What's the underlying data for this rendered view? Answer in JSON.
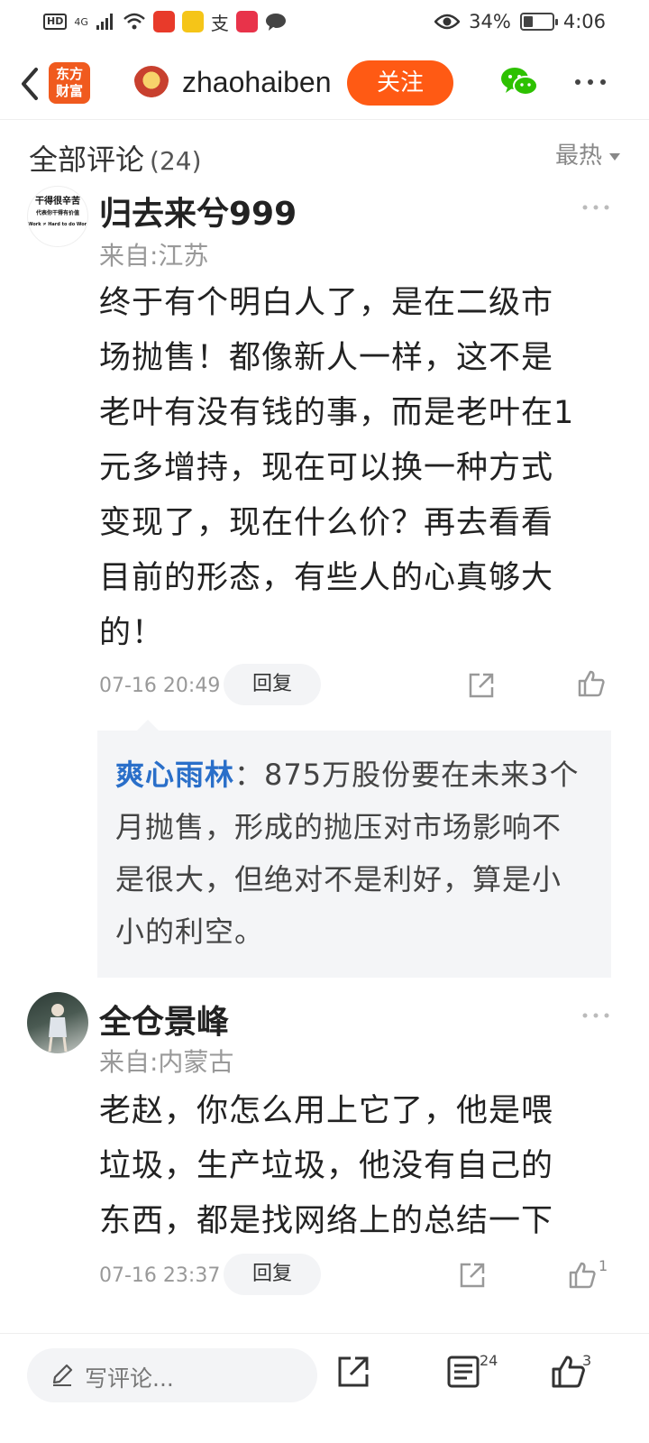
{
  "status_bar": {
    "hd": "HD",
    "network": "4G",
    "battery_percent": "34%",
    "battery_level": 0.34,
    "time": "4:06",
    "app_icons": [
      "app-red-icon",
      "app-yellow-icon",
      "alipay-icon",
      "app-red-2-icon",
      "chat-icon"
    ]
  },
  "nav": {
    "logo_line1": "东方",
    "logo_line2": "财富",
    "username": "zhaohaiben",
    "follow_label": "关注"
  },
  "section": {
    "title": "全部评论",
    "count": "(24)",
    "sort_label": "最热"
  },
  "comments": [
    {
      "name": "归去来兮999",
      "location": "来自:江苏",
      "avatar_text_1": "干得很辛苦",
      "avatar_text_2": "代表你干得有价值",
      "avatar_text_3": "Work ≠ Hard to do Work",
      "lines": [
        "终于有个明白人了，是在二级市",
        "场抛售！都像新人一样，这不是",
        "老叶有没有钱的事，而是老叶在1",
        "元多增持，现在可以换一种方式",
        "变现了，现在什么价？再去看看",
        "目前的形态，有些人的心真够大",
        "的！"
      ],
      "time": "07-16 20:49",
      "reply_label": "回复",
      "reply": {
        "author": "爽心雨林",
        "separator": "：",
        "text_lines": [
          "875万股份要在未来3个",
          "月抛售，形成的抛压对市场影响不",
          "是很大，但绝对不是利好，算是小",
          "小的利空。"
        ]
      }
    },
    {
      "name": "全仓景峰",
      "location": "来自:内蒙古",
      "lines": [
        "老赵，你怎么用上它了，他是喂",
        "垃圾，生产垃圾，他没有自己的",
        "东西，都是找网络上的总结一下"
      ],
      "time": "07-16 23:37",
      "reply_label": "回复",
      "like_count": "1"
    }
  ],
  "bottom_bar": {
    "placeholder": "写评论...",
    "comment_count": "24",
    "like_count": "3"
  },
  "colors": {
    "accent": "#ff5a14",
    "reply_author": "#2a6fc9",
    "muted": "#999999"
  }
}
